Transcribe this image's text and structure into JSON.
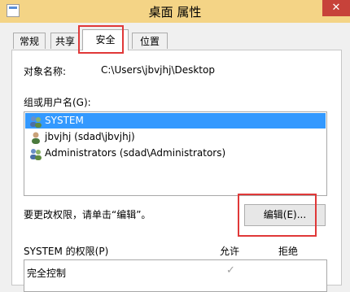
{
  "window": {
    "title": "桌面 属性",
    "close_label": "✕"
  },
  "tabs": [
    {
      "label": "常规"
    },
    {
      "label": "共享"
    },
    {
      "label": "安全"
    },
    {
      "label": "位置"
    }
  ],
  "security": {
    "object_name_label": "对象名称:",
    "object_name_value": "C:\\Users\\jbvjhj\\Desktop",
    "groups_label": "组或用户名(G):",
    "users": [
      {
        "name": "SYSTEM",
        "icon": "group-users-icon",
        "selected": true
      },
      {
        "name": "jbvjhj (sdad\\jbvjhj)",
        "icon": "user-icon",
        "selected": false
      },
      {
        "name": "Administrators (sdad\\Administrators)",
        "icon": "group-users-icon",
        "selected": false
      }
    ],
    "change_permissions_hint": "要更改权限，请单击“编辑”。",
    "edit_button": "编辑(E)...",
    "permissions_label": "SYSTEM 的权限(P)",
    "allow_header": "允许",
    "deny_header": "拒绝",
    "permissions": [
      {
        "name": "完全控制",
        "allow": "✓",
        "deny": ""
      }
    ]
  },
  "colors": {
    "titlebar": "#f4d486",
    "close": "#c7423a",
    "selection": "#3399ff",
    "highlight": "#e03838"
  }
}
